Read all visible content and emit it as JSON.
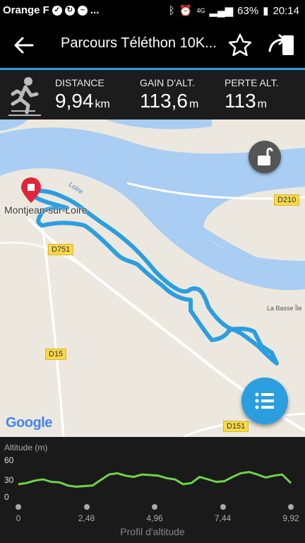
{
  "status_bar": {
    "carrier": "Orange F",
    "ellipsis": "...",
    "network": "4G",
    "battery": "63%",
    "time": "20:14"
  },
  "header": {
    "title": "Parcours Téléthon 10K..."
  },
  "stats": {
    "distance_label": "DISTANCE",
    "distance_value": "9,94",
    "distance_unit": "km",
    "gain_label": "GAIN D'ALT.",
    "gain_value": "113,6",
    "gain_unit": "m",
    "loss_label": "PERTE ALT.",
    "loss_value": "113",
    "loss_unit": "m"
  },
  "map": {
    "town": "Montjean-sur-Loire",
    "river": "Loire",
    "place": "La Basse Île",
    "roads": [
      "D210",
      "D751",
      "D15",
      "D151"
    ],
    "attribution": "Google",
    "route_color": "#2b9ee0",
    "water_color": "#a9cdf3"
  },
  "profile": {
    "y_axis_label": "Altitude (m)",
    "y_ticks": [
      "60",
      "30",
      "0"
    ],
    "x_ticks": [
      "0",
      "2,48",
      "4,96",
      "7,44",
      "9,92"
    ],
    "title": "Profil d'altitude",
    "line_color": "#6fd34a"
  },
  "chart_data": {
    "type": "area",
    "title": "Profil d'altitude",
    "xlabel": "",
    "ylabel": "Altitude (m)",
    "xlim": [
      0,
      9.92
    ],
    "ylim": [
      0,
      60
    ],
    "x": [
      0,
      0.3,
      0.6,
      0.9,
      1.2,
      1.5,
      1.8,
      2.1,
      2.4,
      2.7,
      3.0,
      3.3,
      3.6,
      3.9,
      4.2,
      4.5,
      4.8,
      5.1,
      5.4,
      5.7,
      6.0,
      6.3,
      6.6,
      6.9,
      7.2,
      7.5,
      7.8,
      8.1,
      8.4,
      8.7,
      9.0,
      9.3,
      9.6,
      9.92
    ],
    "series": [
      {
        "values": [
          22,
          24,
          28,
          30,
          26,
          25,
          20,
          18,
          19,
          20,
          29,
          38,
          40,
          36,
          34,
          38,
          37,
          36,
          32,
          30,
          22,
          24,
          34,
          30,
          26,
          27,
          34,
          40,
          42,
          38,
          33,
          36,
          38,
          24
        ]
      }
    ]
  }
}
